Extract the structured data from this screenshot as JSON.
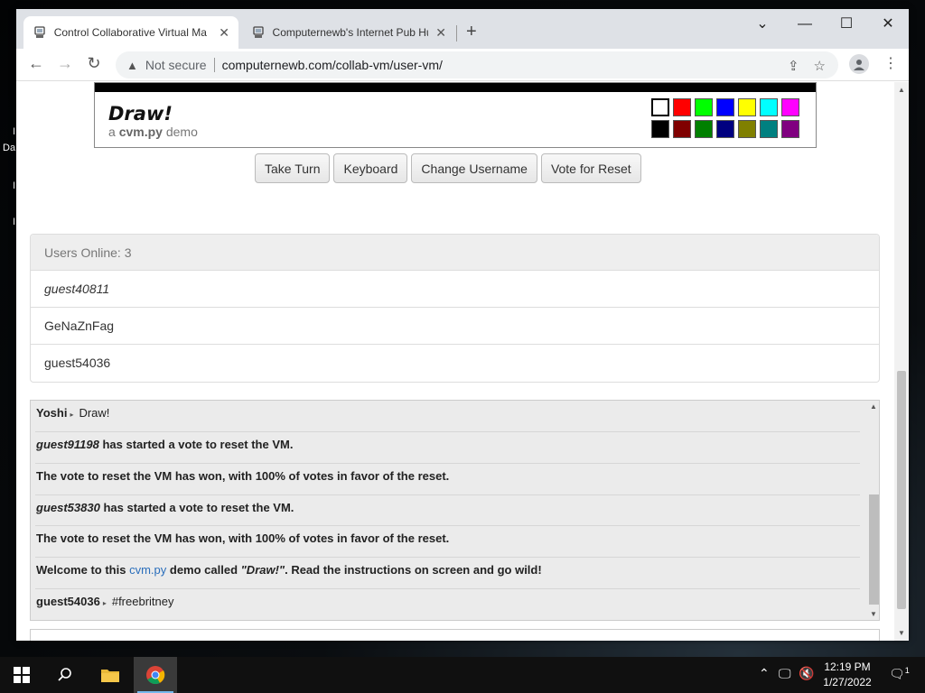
{
  "desktop": {
    "fragments": [
      "I",
      "Da",
      "I",
      "I"
    ]
  },
  "browser": {
    "tabs": [
      {
        "title": "Control Collaborative Virtual Ma",
        "active": true
      },
      {
        "title": "Computernewb's Internet Pub Hu",
        "active": false
      }
    ],
    "new_tab": "+",
    "window_controls": {
      "minimize": "—",
      "maximize": "☐",
      "close": "✕",
      "tablist": "⌄"
    },
    "nav": {
      "back": "←",
      "forward": "→",
      "reload": "↻"
    },
    "address": {
      "security": "Not secure",
      "url": "computernewb.com/collab-vm/user-vm/"
    }
  },
  "vm": {
    "title": "Draw!",
    "subtitle_prefix": "a",
    "subtitle_bold": "cvm.py",
    "subtitle_suffix": "demo",
    "palette": [
      "#ffffff",
      "#ff0000",
      "#00ff00",
      "#0000ff",
      "#ffff00",
      "#00ffff",
      "#ff00ff",
      "#000000",
      "#800000",
      "#008000",
      "#000080",
      "#808000",
      "#008080",
      "#800080"
    ]
  },
  "controls": {
    "take_turn": "Take Turn",
    "keyboard": "Keyboard",
    "change_username": "Change Username",
    "vote_reset": "Vote for Reset"
  },
  "users": {
    "header": "Users Online: 3",
    "list": [
      "guest40811",
      "GeNaZnFag",
      "guest54036"
    ]
  },
  "chat": {
    "m1_user": "Yoshi",
    "m1_text": "Draw!",
    "m2_user": "guest91198",
    "m2_text": "has started a vote to reset the VM.",
    "m3_text": "The vote to reset the VM has won, with 100% of votes in favor of the reset.",
    "m4_user": "guest53830",
    "m4_text": "has started a vote to reset the VM.",
    "m5_text": "The vote to reset the VM has won, with 100% of votes in favor of the reset.",
    "m6_pre": "Welcome to this",
    "m6_link": "cvm.py",
    "m6_mid": "demo called",
    "m6_quote": "\"Draw!\"",
    "m6_post": ". Read the instructions on screen and go wild!",
    "m7_user": "guest54036",
    "m7_text": "#freebritney"
  },
  "taskbar": {
    "time": "12:19 PM",
    "date": "1/27/2022",
    "notification_count": "1"
  }
}
